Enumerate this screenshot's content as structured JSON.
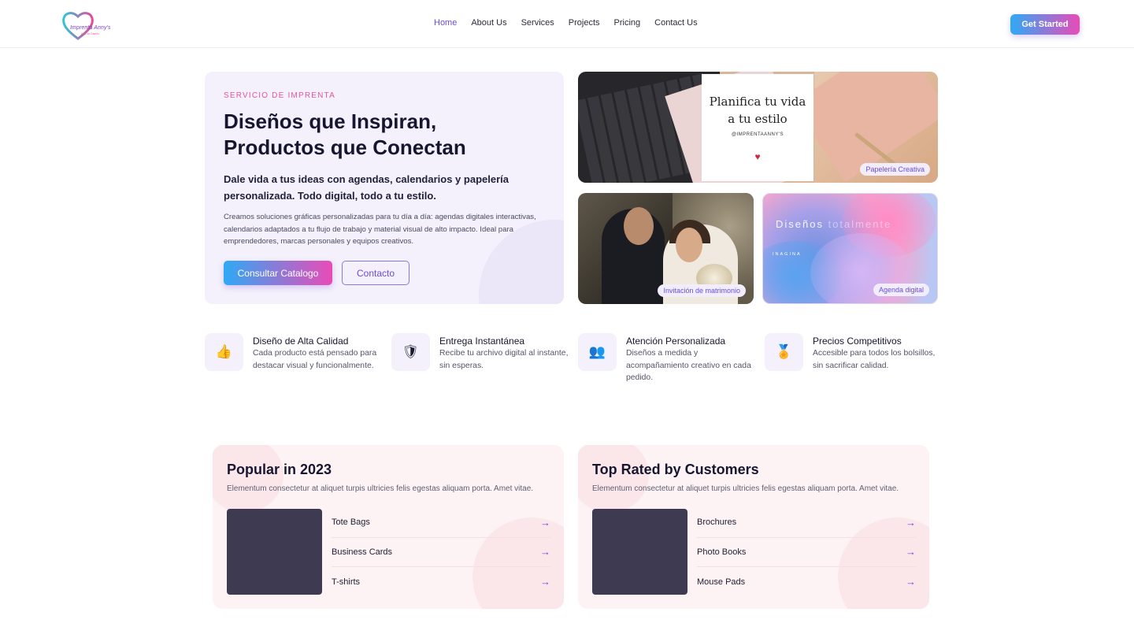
{
  "brand": {
    "logo_text": "Imprenta Anny's",
    "logo_tagline": "Arte de Diseño",
    "colors": {
      "accent": "#6a4ddb",
      "gradient_start": "#2fa9f5",
      "gradient_end": "#e94bb7"
    }
  },
  "nav": {
    "items": [
      "Home",
      "About Us",
      "Services",
      "Projects",
      "Pricing",
      "Contact Us"
    ],
    "active": "Home",
    "cta": "Get Started"
  },
  "hero": {
    "eyebrow": "SERVICIO DE IMPRENTA",
    "title": "Diseños que Inspiran, Productos que Conectan",
    "subtitle": "Dale vida a tus ideas con agendas, calendarios y papelería personalizada. Todo digital, todo a tu estilo.",
    "description": "Creamos soluciones gráficas personalizadas para tu día a día: agendas digitales interactivas, calendarios adaptados a tu flujo de trabajo y material visual de alto impacto. Ideal para emprendedores, marcas personales y equipos creativos.",
    "primary_button": "Consultar Catalogo",
    "secondary_button": "Contacto"
  },
  "gallery": {
    "tiles": [
      {
        "badge": "Papelería Creativa",
        "card_title": "Planifica tu vida a tu estilo",
        "card_handle": "@IMPRENTAANNY'S"
      },
      {
        "badge": "Invitación de matrimonio"
      },
      {
        "badge": "Agenda digital",
        "headline": "Diseños ",
        "headline_faded": "totalmente",
        "subline": "INAGINA"
      }
    ]
  },
  "features": [
    {
      "icon": "thumbs-up-icon",
      "glyph": "👍",
      "title": "Diseño de Alta Calidad",
      "description": "Cada producto está pensado para destacar visual y funcionalmente."
    },
    {
      "icon": "shield-icon",
      "glyph": "🛡",
      "title": "Entrega Instantánea",
      "description": "Recibe tu archivo digital al instante, sin esperas."
    },
    {
      "icon": "people-icon",
      "glyph": "👥",
      "title": "Atención Personalizada",
      "description": "Diseños a medida y acompañamiento creativo en cada pedido."
    },
    {
      "icon": "medal-icon",
      "glyph": "🏅",
      "title": "Precios Competitivos",
      "description": "Accesible para todos los bolsillos, sin sacrificar calidad."
    }
  ],
  "product_cards": [
    {
      "title": "Popular in 2023",
      "description": "Elementum consectetur at aliquet turpis ultricies felis egestas aliquam porta. Amet vitae.",
      "items": [
        "Tote Bags",
        "Business Cards",
        "T-shirts"
      ]
    },
    {
      "title": "Top Rated by Customers",
      "description": "Elementum consectetur at aliquet turpis ultricies felis egestas aliquam porta. Amet vitae.",
      "items": [
        "Brochures",
        "Photo Books",
        "Mouse Pads"
      ]
    }
  ],
  "arrow_glyph": "→"
}
